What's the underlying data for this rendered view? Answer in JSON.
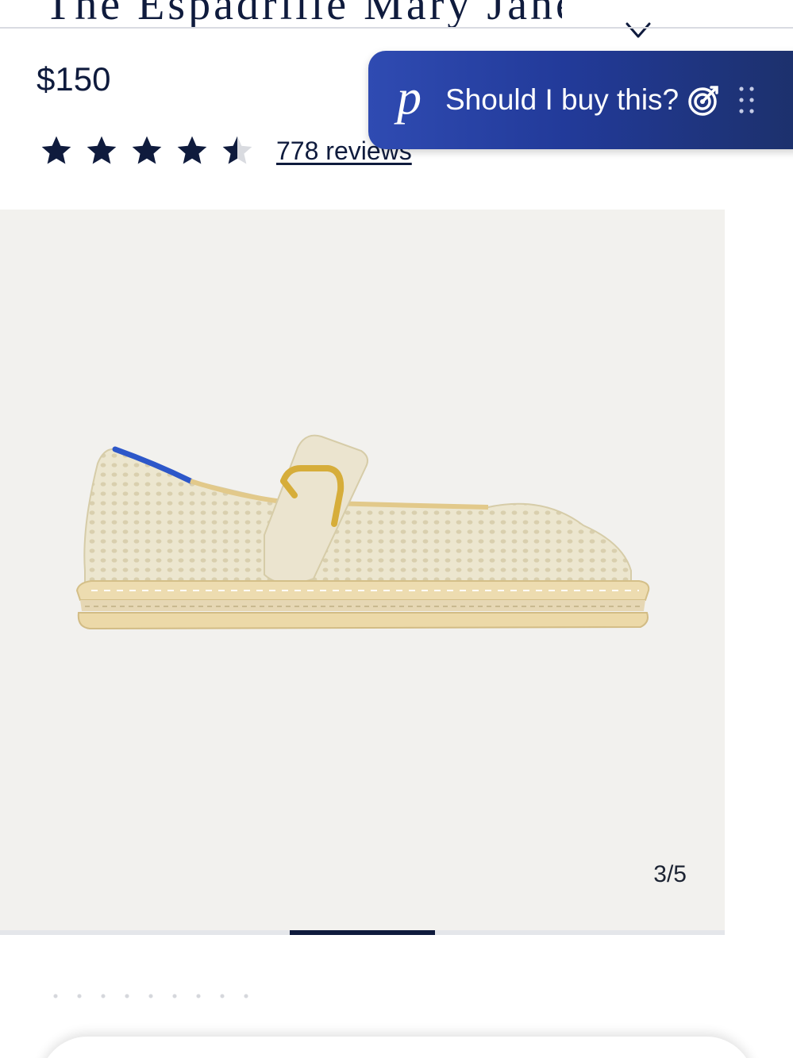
{
  "product": {
    "title": "The Espadrille Mary Jane",
    "price": "$150",
    "rating_value": 4.5,
    "rating_max": 5,
    "reviews_label": "778 reviews"
  },
  "assistant": {
    "logo_letter": "p",
    "label": "Should I buy this?"
  },
  "gallery": {
    "counter": "3/5",
    "current_index": 3,
    "total": 5
  },
  "icons": {
    "favorite": "heart-icon",
    "star": "star-icon",
    "target": "target-icon",
    "drag": "drag-handle-icon"
  },
  "colors": {
    "navy": "#0f1b3d",
    "assistant_start": "#2f4bb2",
    "assistant_end": "#1c3069",
    "gallery_bg": "#f2f1ee"
  }
}
